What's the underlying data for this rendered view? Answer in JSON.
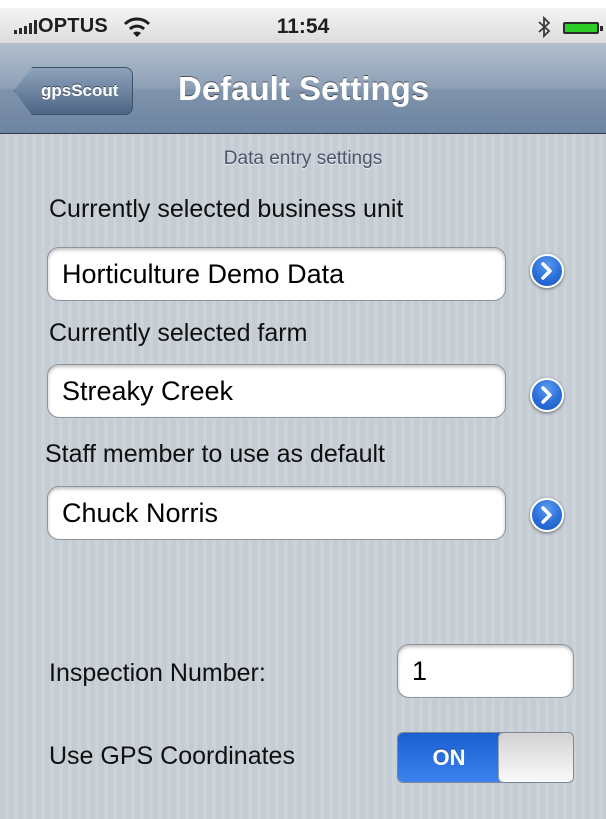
{
  "status_bar": {
    "carrier": "OPTUS",
    "time": "11:54"
  },
  "nav": {
    "back_label": "gpsScout",
    "title": "Default Settings"
  },
  "settings": {
    "section_header": "Data entry settings",
    "business_unit_label": "Currently selected business unit",
    "business_unit_value": "Horticulture Demo Data",
    "farm_label": "Currently selected farm",
    "farm_value": "Streaky Creek",
    "staff_label": "Staff member to use as default",
    "staff_value": "Chuck Norris",
    "inspection_label": "Inspection Number:",
    "inspection_value": "1",
    "gps_label": "Use GPS Coordinates",
    "gps_state": "ON"
  },
  "icons": {
    "signal": "signal-bars-icon",
    "wifi": "wifi-icon",
    "bluetooth": "bluetooth-icon",
    "battery": "battery-icon",
    "disclosure": "chevron-right-circle-icon"
  },
  "colors": {
    "nav_bar": "#8fa1b7",
    "accent_blue": "#2a6fd8",
    "content_background": "#c5ccd4"
  }
}
